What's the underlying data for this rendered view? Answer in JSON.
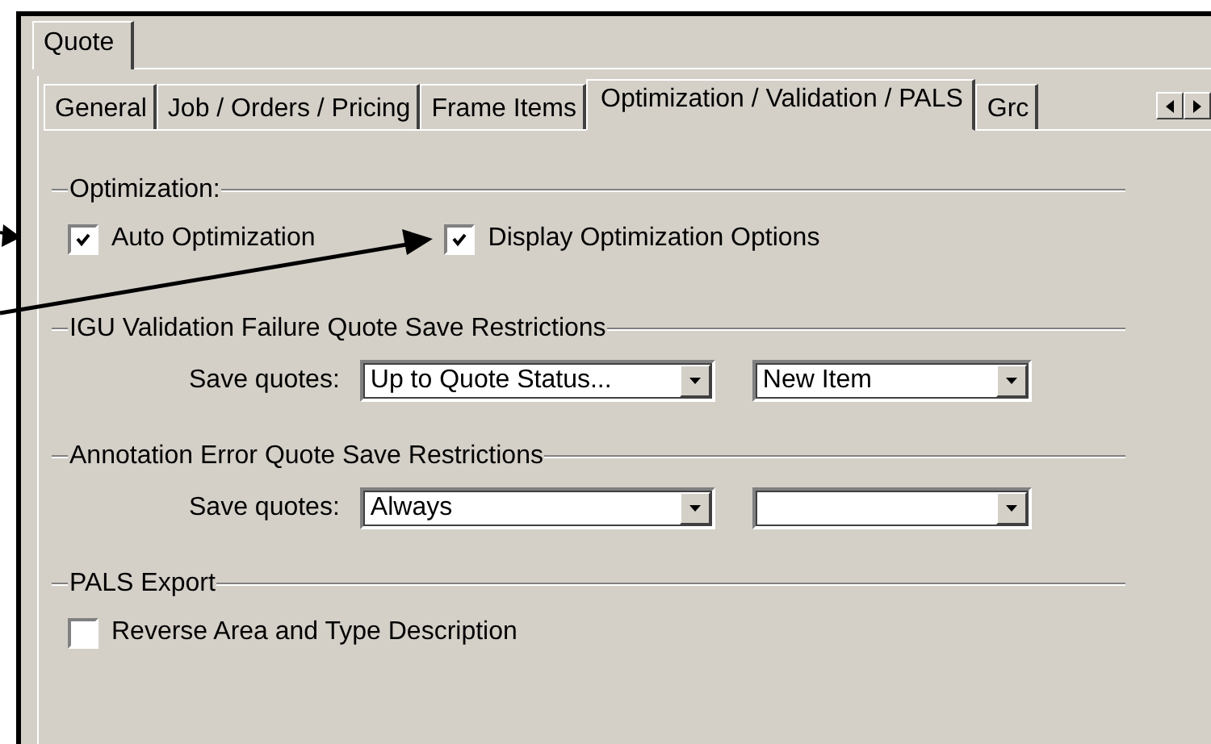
{
  "outer_tabs": [
    {
      "label": "Quote",
      "selected": true
    }
  ],
  "tabs": [
    {
      "label": "General",
      "selected": false
    },
    {
      "label": "Job / Orders / Pricing",
      "selected": false
    },
    {
      "label": "Frame Items",
      "selected": false
    },
    {
      "label": "Optimization / Validation / PALS",
      "selected": true
    },
    {
      "label": "Grc",
      "selected": false
    }
  ],
  "sections": [
    {
      "title": "Optimization:",
      "rows": [
        {
          "kind": "checkboxes",
          "items": [
            {
              "label": "Auto Optimization",
              "checked": true
            },
            {
              "label": "Display Optimization Options",
              "checked": true
            }
          ]
        }
      ]
    },
    {
      "title": "IGU Validation Failure Quote Save Restrictions",
      "rows": [
        {
          "kind": "dropdowns",
          "label": "Save quotes:",
          "dropdowns": [
            {
              "kind": "filled",
              "value": "Up to Quote Status..."
            },
            {
              "kind": "filled",
              "value": "New Item"
            }
          ]
        }
      ]
    },
    {
      "title": "Annotation Error Quote Save Restrictions",
      "rows": [
        {
          "kind": "dropdowns",
          "label": "Save quotes:",
          "dropdowns": [
            {
              "kind": "filled",
              "value": "Always"
            },
            {
              "kind": "blank"
            }
          ]
        }
      ]
    },
    {
      "title": "PALS Export",
      "rows": [
        {
          "kind": "checkboxes",
          "items": [
            {
              "label": "Reverse Area and Type Description",
              "checked": false
            }
          ]
        }
      ]
    }
  ]
}
